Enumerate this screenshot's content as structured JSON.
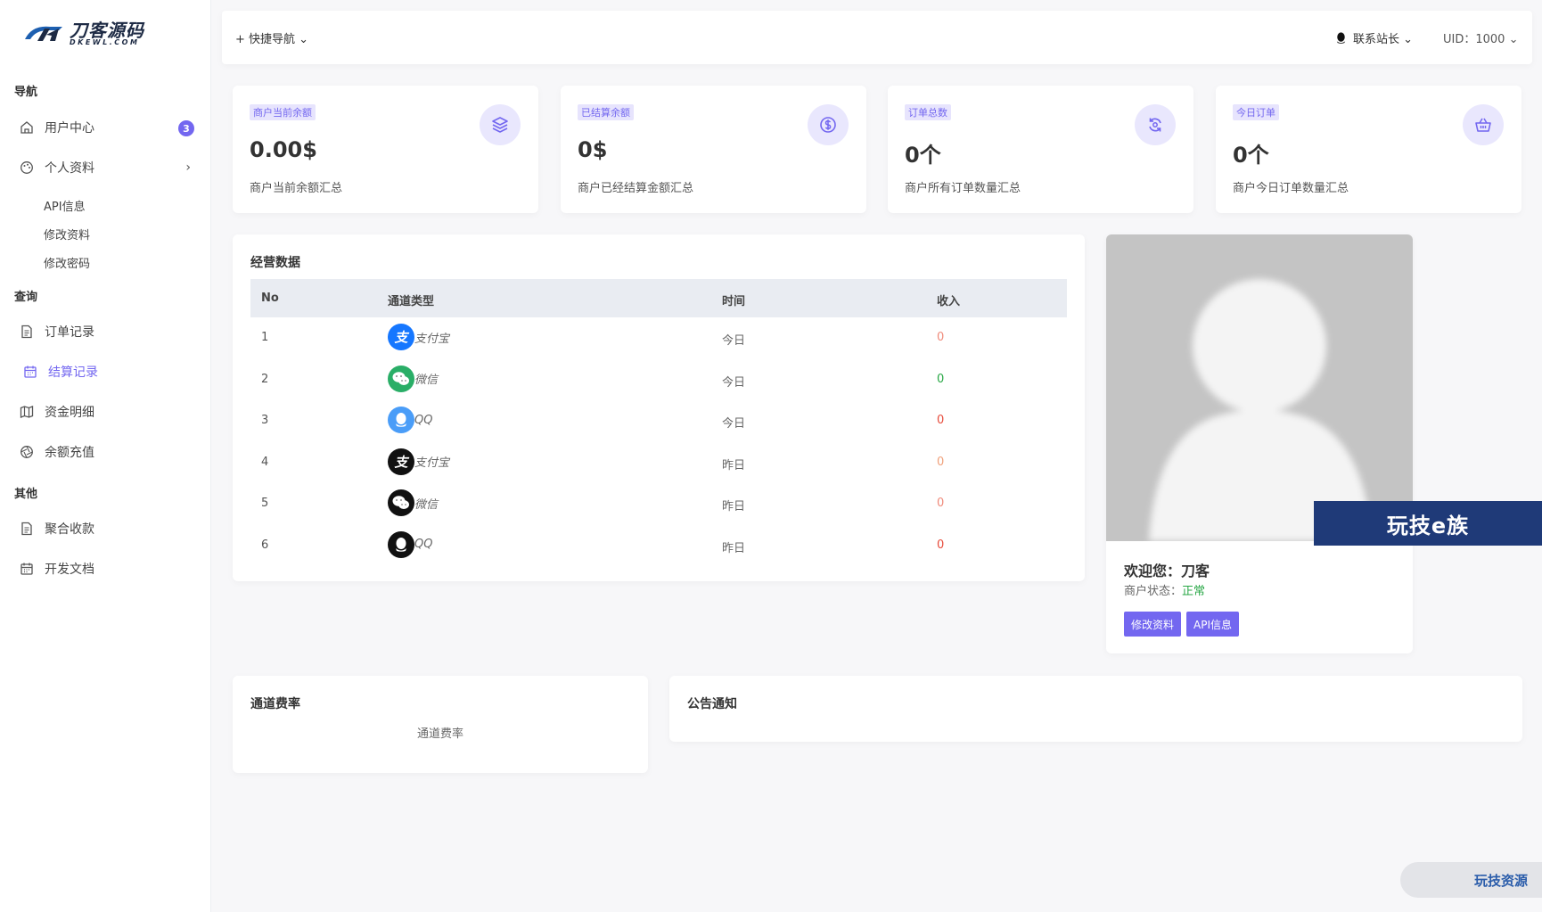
{
  "brand": {
    "title": "刀客源码",
    "sub": "DKEWL.COM"
  },
  "sidebar": {
    "sections": {
      "nav": "导航",
      "query": "查询",
      "other": "其他"
    },
    "items": {
      "user_center": {
        "label": "用户中心",
        "badge": "3"
      },
      "profile": {
        "label": "个人资料"
      },
      "api_info": "API信息",
      "edit_profile": "修改资料",
      "change_password": "修改密码",
      "orders": "订单记录",
      "settlement": "结算记录",
      "funds": "资金明细",
      "recharge": "余额充值",
      "aggregate": "聚合收款",
      "dev_docs": "开发文档"
    }
  },
  "topbar": {
    "quick_nav": "+ 快捷导航 ⌄",
    "contact": "联系站长 ⌄",
    "uid": "UID：1000 ⌄"
  },
  "stats": [
    {
      "tag": "商户当前余额",
      "value": "0.00$",
      "desc": "商户当前余额汇总",
      "icon": "layers-icon"
    },
    {
      "tag": "已结算余额",
      "value": "0$",
      "desc": "商户已经结算金额汇总",
      "icon": "dollar-icon"
    },
    {
      "tag": "订单总数",
      "value": "0个",
      "desc": "商户所有订单数量汇总",
      "icon": "sync-icon"
    },
    {
      "tag": "今日订单",
      "value": "0个",
      "desc": "商户今日订单数量汇总",
      "icon": "basket-icon"
    }
  ],
  "business": {
    "title": "经营数据",
    "headers": [
      "No",
      "通道类型",
      "时间",
      "收入"
    ],
    "rows": [
      {
        "no": "1",
        "channel": "支付宝",
        "time": "今日",
        "income": "0",
        "icon": "alipay-icon",
        "color": "#1677ff",
        "income_color": "#f08a7a"
      },
      {
        "no": "2",
        "channel": "微信",
        "time": "今日",
        "income": "0",
        "icon": "wechat-icon",
        "color": "#2aae67",
        "income_color": "#28a745"
      },
      {
        "no": "3",
        "channel": "QQ",
        "time": "今日",
        "income": "0",
        "icon": "qq-icon",
        "color": "#4a9df8",
        "income_color": "#e74c3c"
      },
      {
        "no": "4",
        "channel": "支付宝",
        "time": "昨日",
        "income": "0",
        "icon": "alipay-icon",
        "color": "#111111",
        "income_color": "#f0a07a"
      },
      {
        "no": "5",
        "channel": "微信",
        "time": "昨日",
        "income": "0",
        "icon": "wechat-icon",
        "color": "#111111",
        "income_color": "#f08a7a"
      },
      {
        "no": "6",
        "channel": "QQ",
        "time": "昨日",
        "income": "0",
        "icon": "qq-icon",
        "color": "#111111",
        "income_color": "#e74c3c"
      }
    ]
  },
  "profile": {
    "welcome": "欢迎您：刀客",
    "status_label": "商户状态：",
    "status_value": "正常",
    "edit_button": "修改资料",
    "api_button": "API信息"
  },
  "watermark": "玩技e族",
  "rate": {
    "title": "通道费率",
    "body": "通道费率"
  },
  "notice": {
    "title": "公告通知"
  },
  "float_pill": "玩技资源",
  "colors": {
    "accent": "#7367f0",
    "accent_light": "#e9e7fd"
  }
}
